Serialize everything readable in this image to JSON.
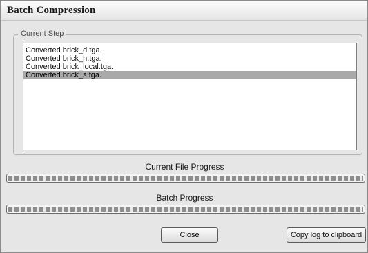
{
  "window": {
    "title": "Batch Compression"
  },
  "current_step": {
    "label": "Current Step",
    "log_lines": [
      {
        "text": "Converted brick_d.tga.",
        "selected": false
      },
      {
        "text": "Converted brick_h.tga.",
        "selected": false
      },
      {
        "text": "Converted brick_local.tga.",
        "selected": false
      },
      {
        "text": "Converted brick_s.tga.",
        "selected": true
      }
    ]
  },
  "file_progress": {
    "label": "Current File Progress",
    "value": 1.0
  },
  "batch_progress": {
    "label": "Batch Progress",
    "value": 1.0
  },
  "buttons": {
    "close": "Close",
    "copy_log": "Copy log to clipboard"
  }
}
